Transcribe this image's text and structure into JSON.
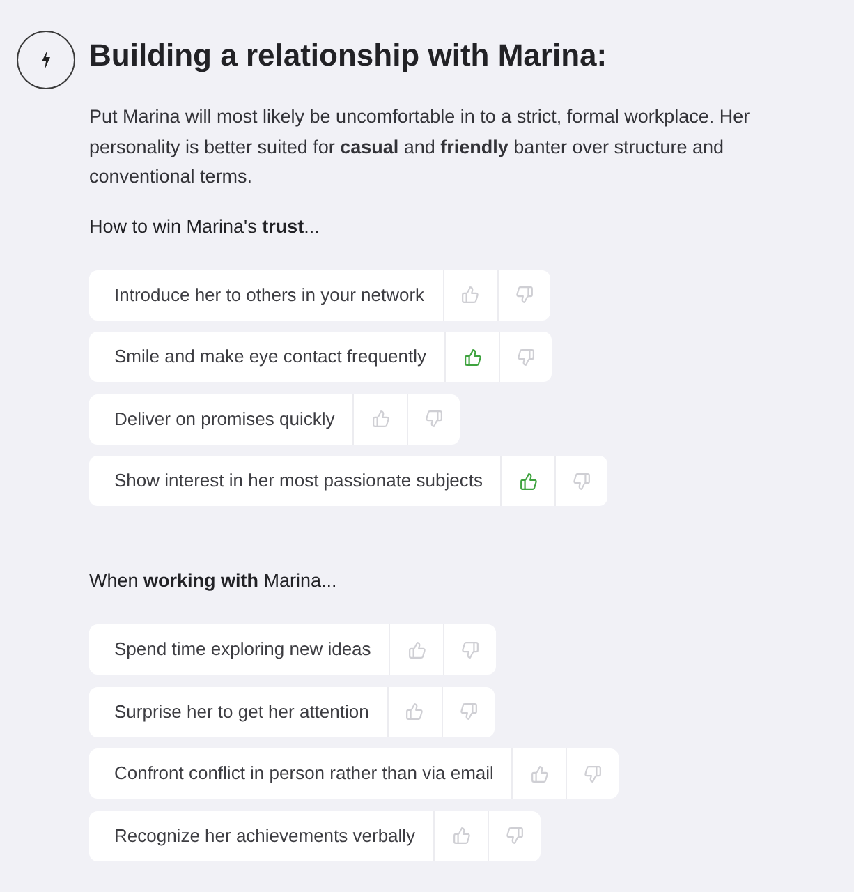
{
  "header": {
    "title": "Building a relationship with Marina:",
    "description": "Put Marina will most likely be uncomfortable in to a strict, formal workplace. Her personality is better suited for **casual** and **friendly** banter over structure and conventional terms."
  },
  "sections": [
    {
      "heading": "How to win Marina's **trust**...",
      "items": [
        {
          "label": "Introduce her to others in your network",
          "liked": false
        },
        {
          "label": "Smile and make eye contact frequently",
          "liked": true
        },
        {
          "label": "Deliver on promises quickly",
          "liked": false
        },
        {
          "label": "Show interest in her most passionate subjects",
          "liked": true
        }
      ]
    },
    {
      "heading": "When **working with** Marina...",
      "items": [
        {
          "label": "Spend time exploring new ideas",
          "liked": false
        },
        {
          "label": "Surprise her to get her attention",
          "liked": false
        },
        {
          "label": "Confront conflict in person rather than via email",
          "liked": false
        },
        {
          "label": "Recognize her achievements verbally",
          "liked": false
        }
      ]
    }
  ]
}
